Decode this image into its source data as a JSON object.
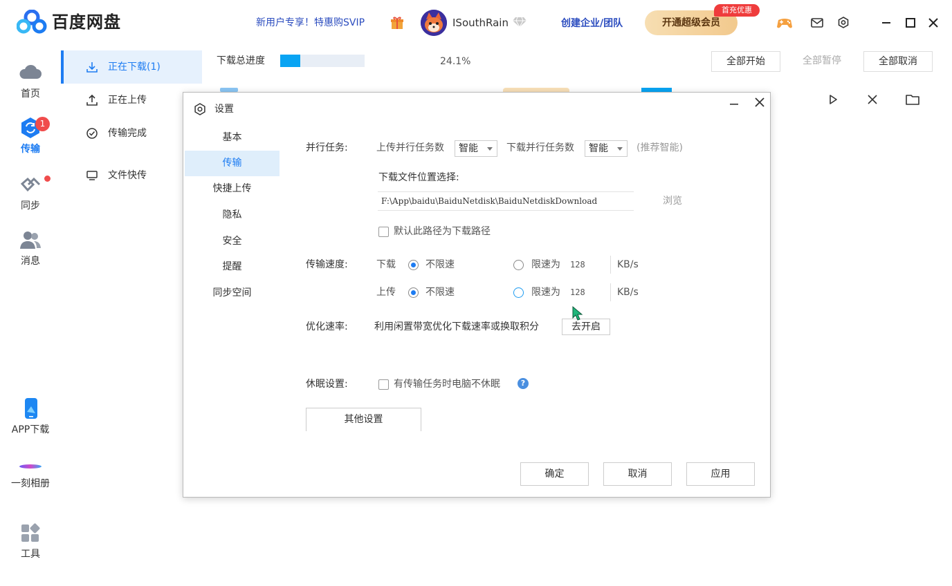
{
  "app": {
    "name": "百度网盘",
    "promo": "新用户专享！特惠购SVIP",
    "username": "ISouthRain",
    "enterprise": "创建企业/团队",
    "vip_button": "开通超级会员",
    "vip_badge": "首充优惠",
    "icons": [
      "gift-icon",
      "avatar",
      "diamond-icon",
      "game-icon",
      "mail-icon",
      "settings-icon",
      "minimize-icon",
      "maximize-icon",
      "close-icon"
    ]
  },
  "nav": {
    "items": [
      {
        "label": "首页",
        "icon": "cloud-icon"
      },
      {
        "label": "传输",
        "icon": "transfer-icon",
        "badge": "1",
        "active": true
      },
      {
        "label": "同步",
        "icon": "sync-icon",
        "dot": true
      },
      {
        "label": "消息",
        "icon": "people-icon"
      },
      {
        "label": "APP下载",
        "icon": "phone-icon"
      },
      {
        "label": "一刻相册",
        "icon": "album-icon"
      },
      {
        "label": "工具",
        "icon": "tools-icon"
      }
    ]
  },
  "transfer_menu": {
    "items": [
      {
        "label": "正在下载(1)",
        "icon": "download-icon",
        "active": true
      },
      {
        "label": "正在上传",
        "icon": "upload-icon"
      },
      {
        "label": "传输完成",
        "icon": "check-circle-icon"
      },
      {
        "label": "文件快传",
        "icon": "monitor-icon"
      }
    ]
  },
  "download": {
    "total_label": "下载总进度",
    "progress": 0.241,
    "percent_text": "24.1%",
    "start_all": "全部开始",
    "pause_all": "全部暂停",
    "cancel_all": "全部取消",
    "row_icons": [
      "play-icon",
      "close-icon",
      "folder-icon"
    ]
  },
  "dialog": {
    "title": "设置",
    "categories": [
      "基本",
      "传输",
      "快捷上传",
      "隐私",
      "安全",
      "提醒",
      "同步空间"
    ],
    "active_category": "传输",
    "parallel": {
      "label": "并行任务:",
      "upload_label": "上传并行任务数",
      "upload_value": "智能",
      "download_label": "下载并行任务数",
      "download_value": "智能",
      "hint": "(推荐智能)"
    },
    "location": {
      "label": "下载文件位置选择:",
      "path": "F:\\App\\baidu\\BaiduNetdisk\\BaiduNetdiskDownload",
      "browse": "浏览",
      "default_checkbox": "默认此路径为下载路径"
    },
    "speed": {
      "label": "传输速度:",
      "download_label": "下载",
      "upload_label": "上传",
      "unlimited": "不限速",
      "limit_to": "限速为",
      "download_limit": "128",
      "upload_limit": "128",
      "unit": "KB/s"
    },
    "optimize": {
      "label": "优化速率:",
      "text": "利用闲置带宽优化下载速率或换取积分",
      "button": "去开启"
    },
    "sleep": {
      "label": "休眠设置:",
      "checkbox": "有传输任务时电脑不休眠",
      "help": "?"
    },
    "other_settings": "其他设置",
    "ok": "确定",
    "cancel": "取消",
    "apply": "应用"
  }
}
